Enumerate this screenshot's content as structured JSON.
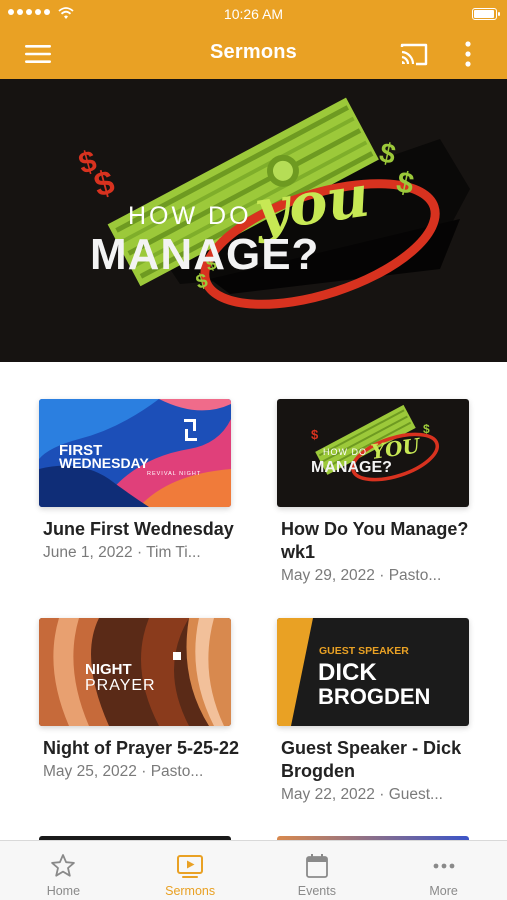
{
  "status_bar": {
    "time": "10:26 AM",
    "battery_level": 0.95
  },
  "nav": {
    "title": "Sermons",
    "menu_icon": "hamburger-menu-icon",
    "cast_icon": "cast-icon",
    "more_icon": "vertical-ellipsis-icon"
  },
  "hero": {
    "line1": "HOW DO",
    "script_word": "you",
    "line2": "MANAGE?"
  },
  "cards": [
    {
      "title": "June First Wednesday",
      "subtitle": "June 1, 2022 · Tim Ti...",
      "thumb": {
        "line1": "FIRST",
        "line2": "WEDNESDAY",
        "tag": "REVIVAL NIGHT"
      }
    },
    {
      "title": "How Do You Manage? wk1",
      "subtitle": "May 29, 2022 · Pasto...",
      "thumb": {
        "line1": "HOW DO",
        "script_word": "YOU",
        "line2": "MANAGE?"
      }
    },
    {
      "title": "Night of Prayer 5-25-22",
      "subtitle": "May 25, 2022 · Pasto...",
      "thumb": {
        "line1": "NIGHT",
        "line2": "PRAYER"
      }
    },
    {
      "title": "Guest Speaker - Dick Brogden",
      "subtitle": "May 22, 2022 · Guest...",
      "thumb": {
        "tag": "GUEST SPEAKER",
        "line1": "DICK",
        "line2": "BROGDEN"
      }
    }
  ],
  "tab_bar": [
    {
      "label": "Home",
      "icon": "star-icon",
      "active": false
    },
    {
      "label": "Sermons",
      "icon": "video-icon",
      "active": true
    },
    {
      "label": "Events",
      "icon": "calendar-icon",
      "active": false
    },
    {
      "label": "More",
      "icon": "horizontal-ellipsis-icon",
      "active": false
    }
  ],
  "colors": {
    "brand": "#e9a124",
    "hero_background": "#161311",
    "money_green": "#9cc93a",
    "accent_red": "#d8321f",
    "text_dark": "#222222",
    "text_muted": "#7a7a7a",
    "tab_inactive": "#8a8a8a"
  }
}
